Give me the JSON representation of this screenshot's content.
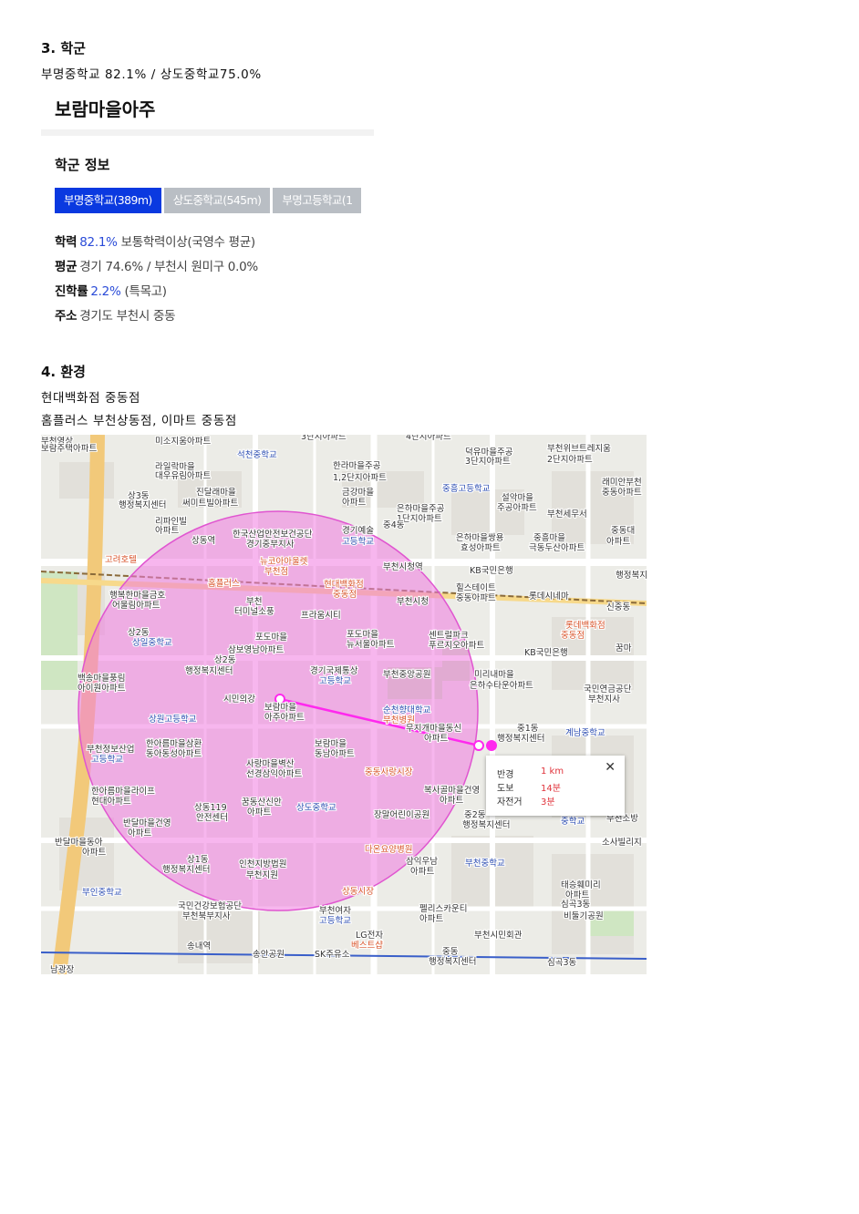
{
  "section3": {
    "heading": "3. 학군",
    "summary": "부명중학교 82.1% / 상도중학교75.0%"
  },
  "school_panel": {
    "apartment": "보람마을아주",
    "title": "학군 정보",
    "tabs": [
      "부명중학교(389m)",
      "상도중학교(545m)",
      "부명고등학교(1"
    ],
    "rows": [
      {
        "label": "학력",
        "highlight": "82.1%",
        "text": " 보통학력이상(국영수 평균)"
      },
      {
        "label": "평균",
        "highlight": "",
        "text": "경기 74.6% / 부천시 원미구 0.0%"
      },
      {
        "label": "진학률",
        "highlight": "2.2%",
        "text": " (특목고)"
      },
      {
        "label": "주소",
        "highlight": "",
        "text": "경기도 부천시 중동"
      }
    ],
    "accent_color": "#0a39e0"
  },
  "section4": {
    "heading": "4. 환경",
    "line1": "현대백화점 중동점",
    "line2": "홈플러스 부천상동점, 이마트 중동점"
  },
  "map": {
    "popup": {
      "rows": [
        {
          "label": "반경",
          "value": "1 km"
        },
        {
          "label": "도보",
          "value": "14분"
        },
        {
          "label": "자전거",
          "value": "3분"
        }
      ],
      "close": "✕"
    },
    "labels": [
      "부천영상",
      "미소지움아파트",
      "3단지아파트",
      "4단지아파트",
      "덕유마을주공",
      "부천위브트레지움",
      "보람주택아파트",
      "석천중학교",
      "한라마을주공",
      "3단지아파트",
      "2단지아파트",
      "라일락마을",
      "대우유림아파트",
      "1,2단지아파트",
      "중흥고등학교",
      "래미안부천",
      "중동아파트",
      "상3동",
      "행정복지센터",
      "진달래마을",
      "써미트빌아파트",
      "금강마을",
      "아파트",
      "은하마을주공",
      "1단지아파트",
      "설악마을",
      "주공아파트",
      "부천세무서",
      "리파인빌",
      "아파트",
      "상동역",
      "한국산업안전보건공단",
      "경기중부지사",
      "경기예술",
      "고등학교",
      "중4동",
      "은하마을쌍용",
      "효성아파트",
      "중흥마을",
      "극동두산아파트",
      "중동대",
      "아파트",
      "고려호텔",
      "뉴코아아울렛",
      "부천점",
      "부천시청역",
      "KB국민은행",
      "행정복지",
      "홈플러스",
      "현대백화점",
      "중동점",
      "힐스테이트",
      "중동아파트",
      "롯데시네마",
      "신중동",
      "행복한마을금호",
      "어울림아파트",
      "부천",
      "터미널소풍",
      "부천시청",
      "프라움시티",
      "롯데백화점",
      "중동점",
      "상2동",
      "상일중학교",
      "포도마을",
      "삼보영남아파트",
      "포도마을",
      "뉴서울아파트",
      "센트럴파크",
      "푸르지오아파트",
      "KB국민은행",
      "꿈마",
      "경기국제통상",
      "고등학교",
      "부천중앙공원",
      "미리내마을",
      "은하수타운아파트",
      "국민연금공단",
      "부천지사",
      "백송마을풍림",
      "아이원아파트",
      "상2동",
      "행정복지센터",
      "시민의강",
      "보람마을",
      "아주아파트",
      "순천향대학교",
      "부천병원",
      "상원고등학교",
      "무지개마을동신",
      "아파트",
      "중1동",
      "행정복지센터",
      "계남중학교",
      "부천정보산업",
      "고등학교",
      "한아름마을삼환",
      "동아동성아파트",
      "보람마을",
      "동남아파트",
      "사랑마을벽산",
      "선경삼익아파트",
      "중동사랑시장",
      "한아름마을라이프",
      "현대아파트",
      "상동119",
      "안전센터",
      "꿈동산신안",
      "아파트",
      "상도중학교",
      "복사골마을건영",
      "아파트",
      "장말어린이공원",
      "중2동",
      "행정복지센터",
      "반달마을건영",
      "아파트",
      "반달마을동아",
      "아파트",
      "다온요양병원",
      "상1동",
      "행정복지센터",
      "인천지방법원",
      "부천지원",
      "삼익우남",
      "아파트",
      "부천중학교",
      "태승훼미리",
      "아파트",
      "심곡3동",
      "비둘기공원",
      "부인중학교",
      "상동시장",
      "국민건강보험공단",
      "부천북부지사",
      "부천여자",
      "고등학교",
      "LG전자",
      "베스트샵",
      "펠리스카운티",
      "아파트",
      "부천시민회관",
      "송내역",
      "송안공원",
      "SK주유소",
      "중동",
      "행정복지센터",
      "심곡3동",
      "남광장",
      "소사빌리지",
      "중학교",
      "부천소방"
    ]
  }
}
